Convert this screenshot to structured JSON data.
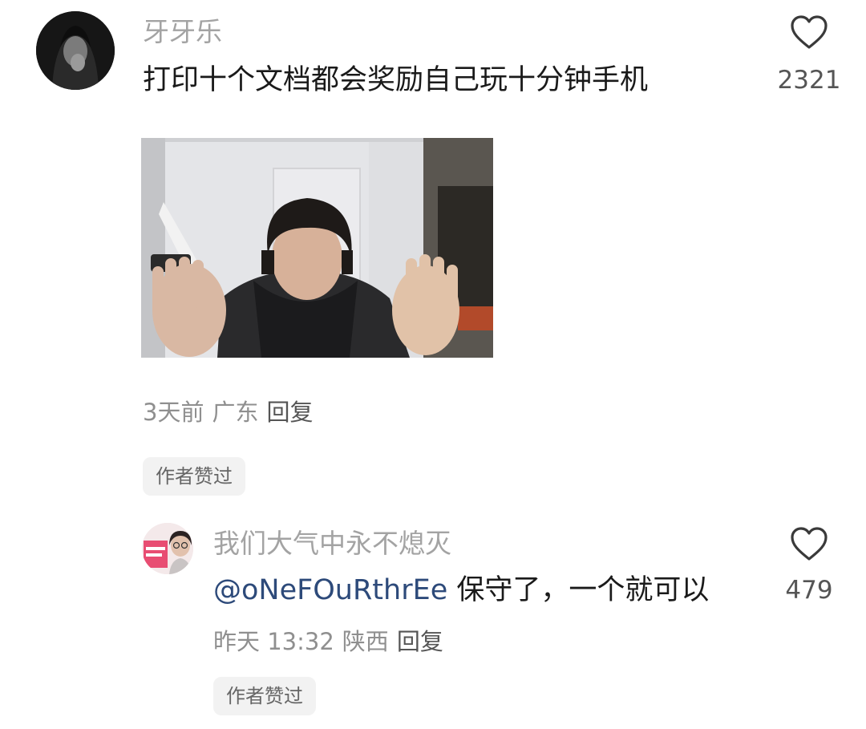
{
  "comment1": {
    "username": "牙牙乐",
    "text": "打印十个文档都会奖励自己玩十分钟手机",
    "time": "3天前",
    "location": "广东",
    "reply_label": "回复",
    "badge": "作者赞过",
    "likes": "2321",
    "image_icon": "photo-of-person-raising-both-hands"
  },
  "comment2": {
    "username": "我们大气中永不熄灭",
    "mention": "@oNeFOuRthrEe",
    "text": "保守了，一个就可以",
    "time": "昨天 13:32",
    "location": "陕西",
    "reply_label": "回复",
    "badge": "作者赞过",
    "likes": "479"
  },
  "icons": {
    "like": "heart-outline-icon"
  },
  "colors": {
    "username": "#a3a3a3",
    "mention": "#2d4a7a",
    "badge_bg": "#f2f2f2"
  }
}
